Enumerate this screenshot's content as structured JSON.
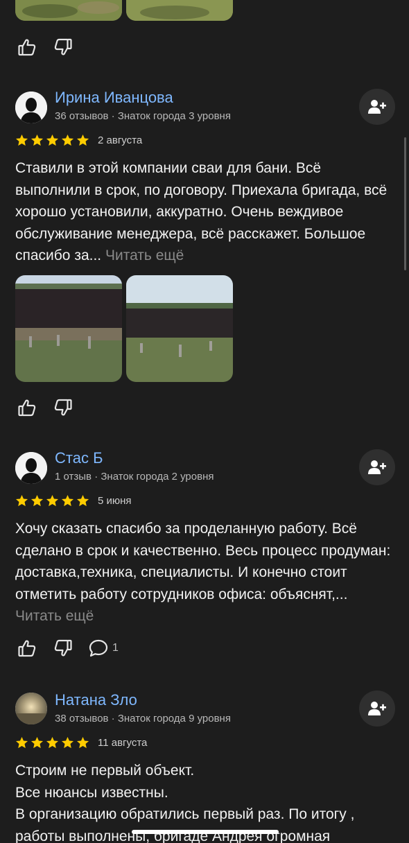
{
  "reviews": [
    {
      "author": "Ирина Иванцова",
      "meta": "36 отзывов · Знаток города 3 уровня",
      "rating": 5,
      "date": "2 августа",
      "text": "Ставили в этой компании сваи для бани. Всё выполнили в срок, по договору. Приехала бригада, всё хорошо установили, аккуратно. Очень веждивое обслуживание менеджера, всё расскажет. Большое спасибо за...",
      "read_more": "Читать ещё"
    },
    {
      "author": "Стас Б",
      "meta": "1 отзыв · Знаток города 2 уровня",
      "rating": 5,
      "date": "5 июня",
      "text": "Хочу сказать спасибо за проделанную работу. Всё сделано в срок и качественно. Весь процесс продуман: доставка,техника, специалисты. И конечно стоит отметить работу сотрудников офиса: объяснят,...",
      "read_more": "Читать ещё",
      "comments": "1"
    },
    {
      "author": "Натана Зло",
      "meta": "38 отзывов · Знаток города 9 уровня",
      "rating": 5,
      "date": "11 августа",
      "text_lines": [
        "Строим не первый объект.",
        "Все нюансы известны.",
        "В организацию обратились первый раз. По итогу ,",
        "работы выполнены, бригаде Андрея огромная"
      ]
    }
  ],
  "icons": {
    "like": "thumbs-up-icon",
    "dislike": "thumbs-down-icon",
    "comment": "comment-icon",
    "follow": "add-user-icon",
    "star": "star-icon"
  },
  "colors": {
    "background": "#1d1d1d",
    "author_link": "#7fb8ff",
    "star": "#ffcc00",
    "read_more": "#8a8a8a"
  }
}
